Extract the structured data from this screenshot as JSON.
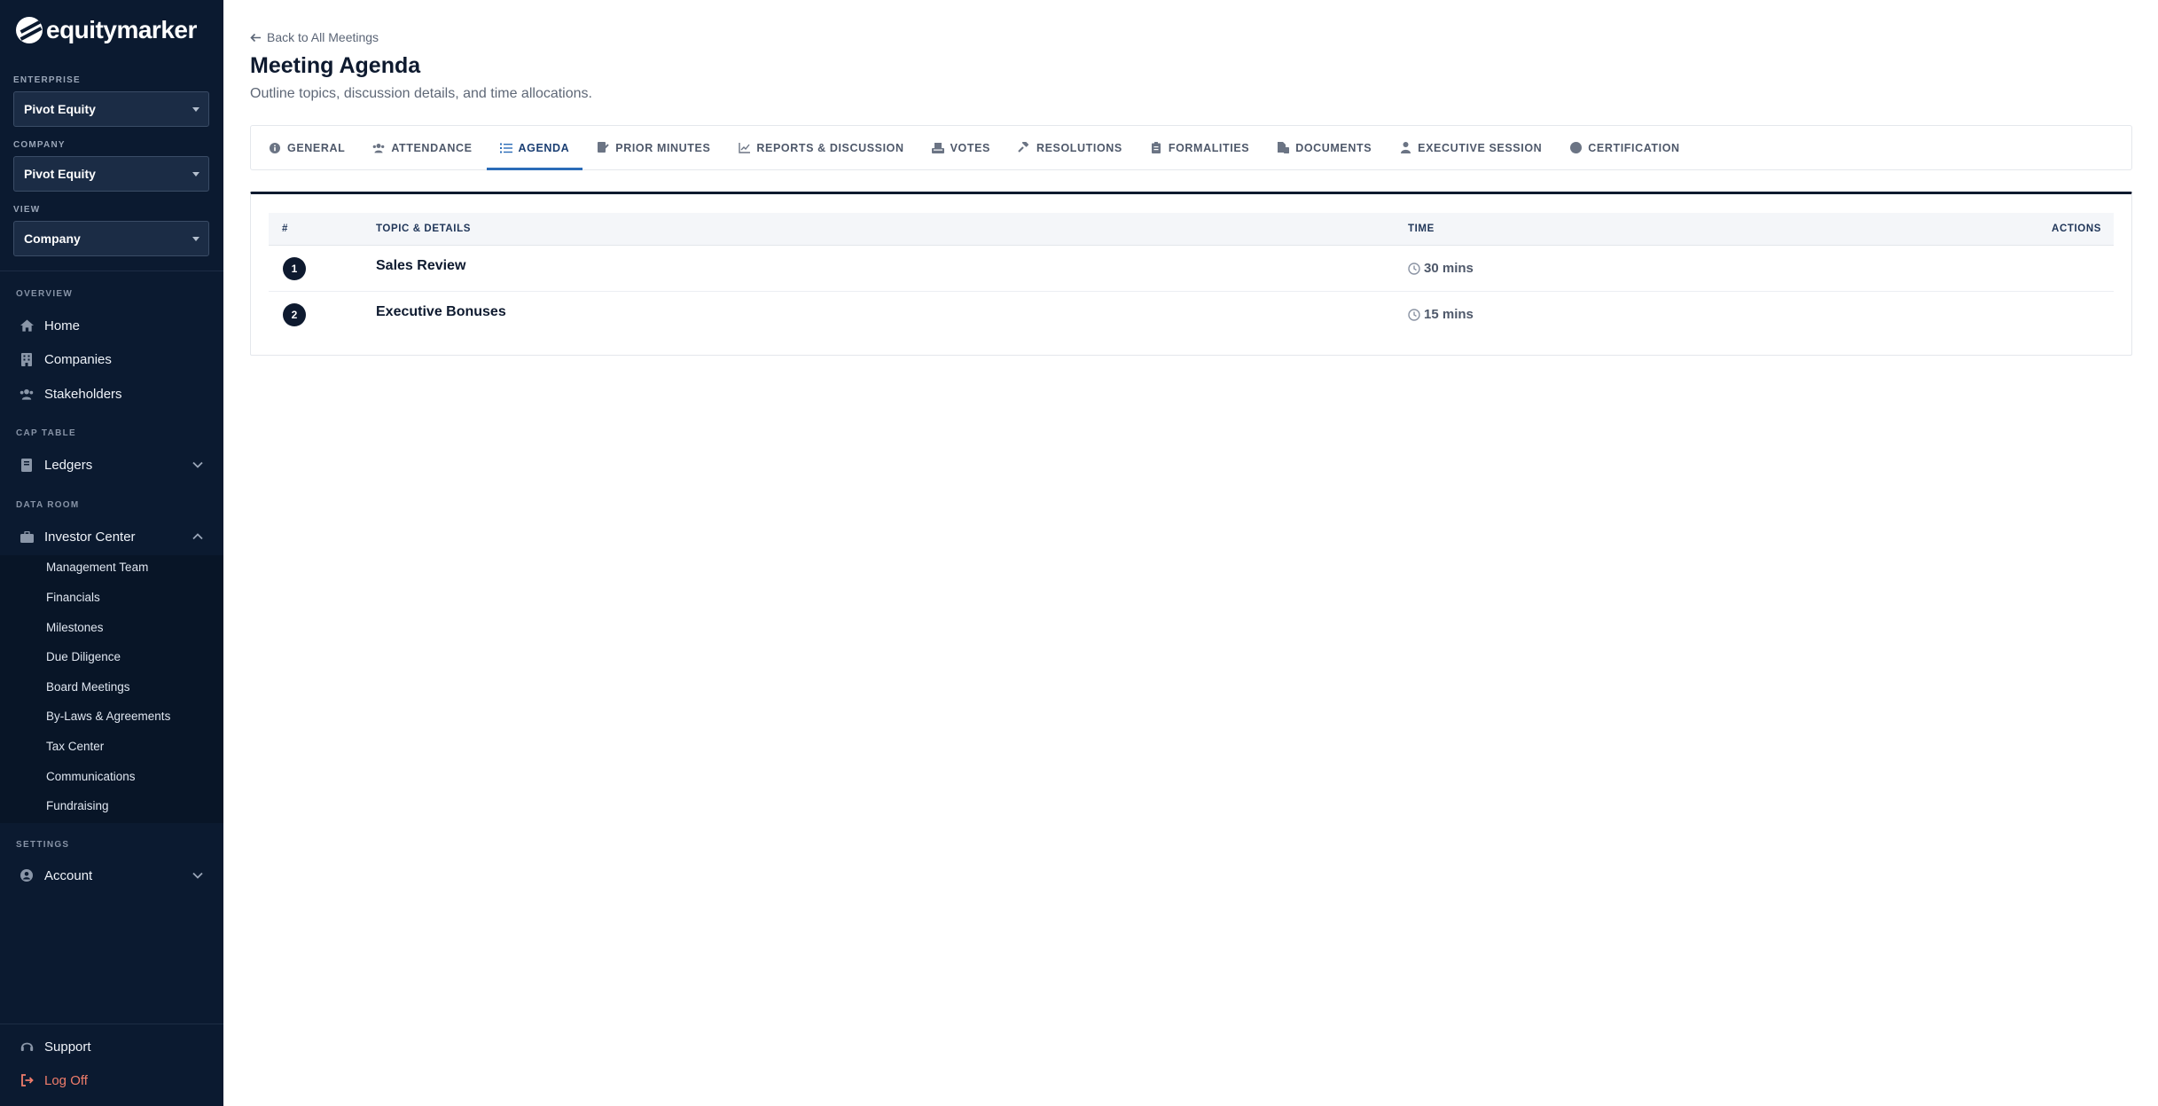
{
  "brand": {
    "name": "equitymarker"
  },
  "selectors": [
    {
      "label": "ENTERPRISE",
      "value": "Pivot Equity"
    },
    {
      "label": "COMPANY",
      "value": "Pivot Equity"
    },
    {
      "label": "VIEW",
      "value": "Company"
    }
  ],
  "nav": {
    "overview_label": "OVERVIEW",
    "home": "Home",
    "companies": "Companies",
    "stakeholders": "Stakeholders",
    "captable_label": "CAP TABLE",
    "ledgers": "Ledgers",
    "dataroom_label": "DATA ROOM",
    "investor_center": "Investor Center",
    "sub_items": [
      "Management Team",
      "Financials",
      "Milestones",
      "Due Diligence",
      "Board Meetings",
      "By-Laws & Agreements",
      "Tax Center",
      "Communications",
      "Fundraising"
    ],
    "settings_label": "SETTINGS",
    "account": "Account",
    "support": "Support",
    "logoff": "Log Off"
  },
  "header": {
    "back": "Back to All Meetings",
    "title": "Meeting Agenda",
    "subtitle": "Outline topics, discussion details, and time allocations."
  },
  "tabs": [
    {
      "label": "GENERAL",
      "icon": "info-icon"
    },
    {
      "label": "ATTENDANCE",
      "icon": "users-icon"
    },
    {
      "label": "AGENDA",
      "icon": "list-icon",
      "active": true
    },
    {
      "label": "PRIOR MINUTES",
      "icon": "file-signature-icon"
    },
    {
      "label": "REPORTS & DISCUSSION",
      "icon": "chart-line-icon"
    },
    {
      "label": "VOTES",
      "icon": "ballot-box-icon"
    },
    {
      "label": "RESOLUTIONS",
      "icon": "gavel-icon"
    },
    {
      "label": "FORMALITIES",
      "icon": "clipboard-icon"
    },
    {
      "label": "DOCUMENTS",
      "icon": "file-icon"
    },
    {
      "label": "EXECUTIVE SESSION",
      "icon": "user-tie-icon"
    },
    {
      "label": "CERTIFICATION",
      "icon": "seal-icon"
    }
  ],
  "table": {
    "headers": {
      "num": "#",
      "topic": "TOPIC & DETAILS",
      "time": "TIME",
      "actions": "ACTIONS"
    },
    "rows": [
      {
        "num": "1",
        "topic": "Sales Review",
        "time": "30 mins"
      },
      {
        "num": "2",
        "topic": "Executive Bonuses",
        "time": "15 mins"
      }
    ]
  },
  "colors": {
    "sidebar_bg": "#0b1a30",
    "accent": "#2b6cb8",
    "dark": "#0e1a2f",
    "logoff": "#f07d6b"
  }
}
